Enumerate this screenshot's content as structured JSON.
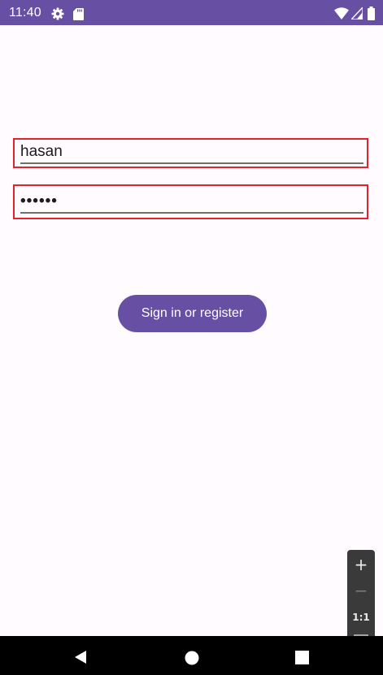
{
  "status_bar": {
    "time": "11:40",
    "icons": [
      "gear-icon",
      "sd-card-icon",
      "wifi-icon",
      "signal-icon",
      "battery-icon"
    ],
    "color": "#6750a4"
  },
  "form": {
    "username_value": "hasan",
    "password_value": "••••••",
    "highlight_color": "#e0242f"
  },
  "signin_button": {
    "label": "Sign in or register",
    "color": "#6750a4"
  },
  "zoom_controls": {
    "zoom_in": "+",
    "zoom_out": "−",
    "reset_label": "1:1",
    "fit_icon": "fit-screen-icon"
  },
  "nav_bar": {
    "icons": [
      "back-icon",
      "home-icon",
      "recents-icon"
    ]
  }
}
